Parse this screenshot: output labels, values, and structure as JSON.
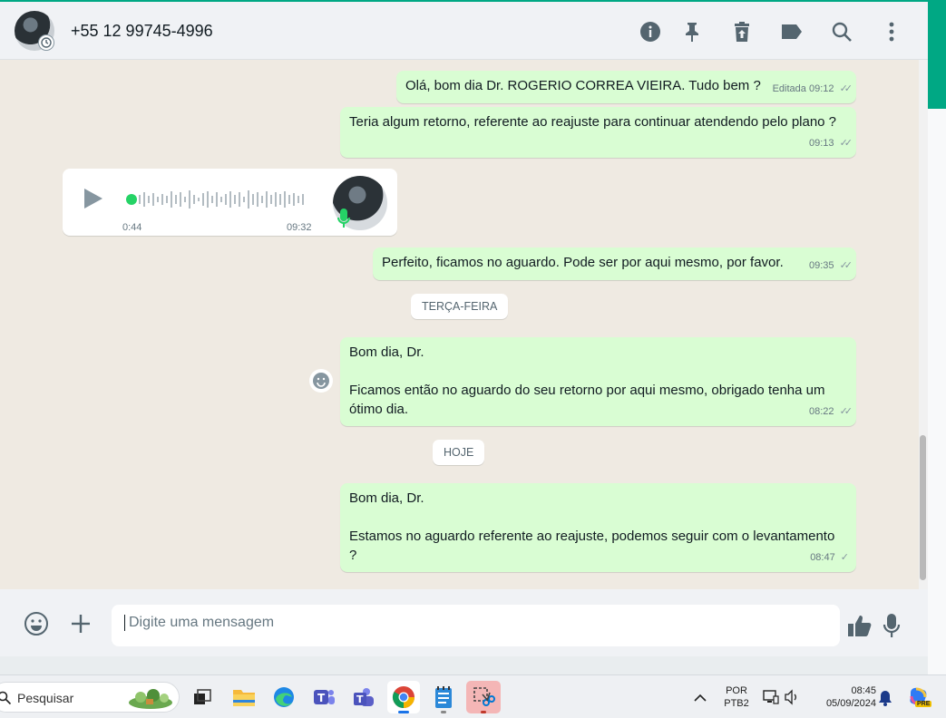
{
  "header": {
    "contact_name": "+55 12 99745-4996"
  },
  "messages": [
    {
      "type": "out",
      "text": "Olá, bom dia Dr. ROGERIO CORREA VIEIRA. Tudo bem ?",
      "edited": "Editada",
      "time": "09:12"
    },
    {
      "type": "out",
      "text": "Teria algum retorno, referente ao reajuste para continuar atendendo pelo plano ?",
      "time": "09:13"
    },
    {
      "type": "audio",
      "duration": "0:44",
      "time": "09:32"
    },
    {
      "type": "out",
      "text": "Perfeito, ficamos no aguardo. Pode ser por aqui mesmo, por favor.",
      "time": "09:35"
    },
    {
      "type": "out",
      "line1": "Bom dia, Dr.",
      "line2": "Ficamos então no aguardo do seu retorno por aqui mesmo, obrigado tenha um ótimo dia.",
      "time": "08:22"
    },
    {
      "type": "out",
      "line1": "Bom dia, Dr.",
      "line2": "Estamos no aguardo referente ao reajuste, podemos seguir com o levantamento ?",
      "time": "08:47"
    }
  ],
  "day_chips": [
    "TERÇA-FEIRA",
    "HOJE"
  ],
  "input": {
    "placeholder": "Digite uma mensagem"
  },
  "taskbar": {
    "search_label": "Pesquisar",
    "lang_line1": "POR",
    "lang_line2": "PTB2",
    "time": "08:45",
    "date": "05/09/2024",
    "copilot_badge": "PRE"
  },
  "colors": {
    "accent": "#00a884",
    "outgoing_bubble": "#d9fdd3",
    "chat_bg": "#efeae2",
    "tick": "#8696a0"
  },
  "icons": {
    "header": [
      "info-icon",
      "pin-icon",
      "delete-icon",
      "label-icon",
      "search-icon",
      "menu-icon"
    ],
    "input": [
      "emoji-icon",
      "attach-plus-icon",
      "thumbs-up-icon",
      "microphone-icon"
    ]
  }
}
